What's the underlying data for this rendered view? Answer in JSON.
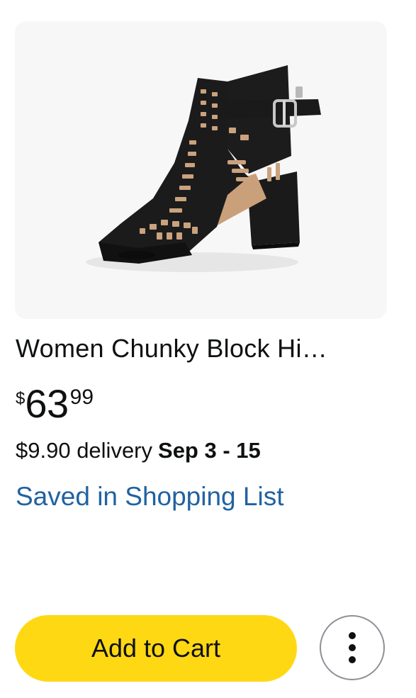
{
  "product": {
    "image_alt": "Black cut-out block heel sandal",
    "title": "Women Chunky Block Hi…",
    "price": {
      "symbol": "$",
      "whole": "63",
      "fraction": "99"
    },
    "delivery": {
      "fee_text": "$9.90 delivery",
      "date_text": "Sep 3 - 15"
    },
    "saved_status": "Saved in Shopping List"
  },
  "actions": {
    "add_to_cart_label": "Add to Cart",
    "more_options_icon": "more-vertical-icon"
  },
  "colors": {
    "button_yellow": "#ffd814",
    "link_blue": "#2162a1",
    "image_background": "#f7f7f7",
    "text_primary": "#0f1111"
  }
}
